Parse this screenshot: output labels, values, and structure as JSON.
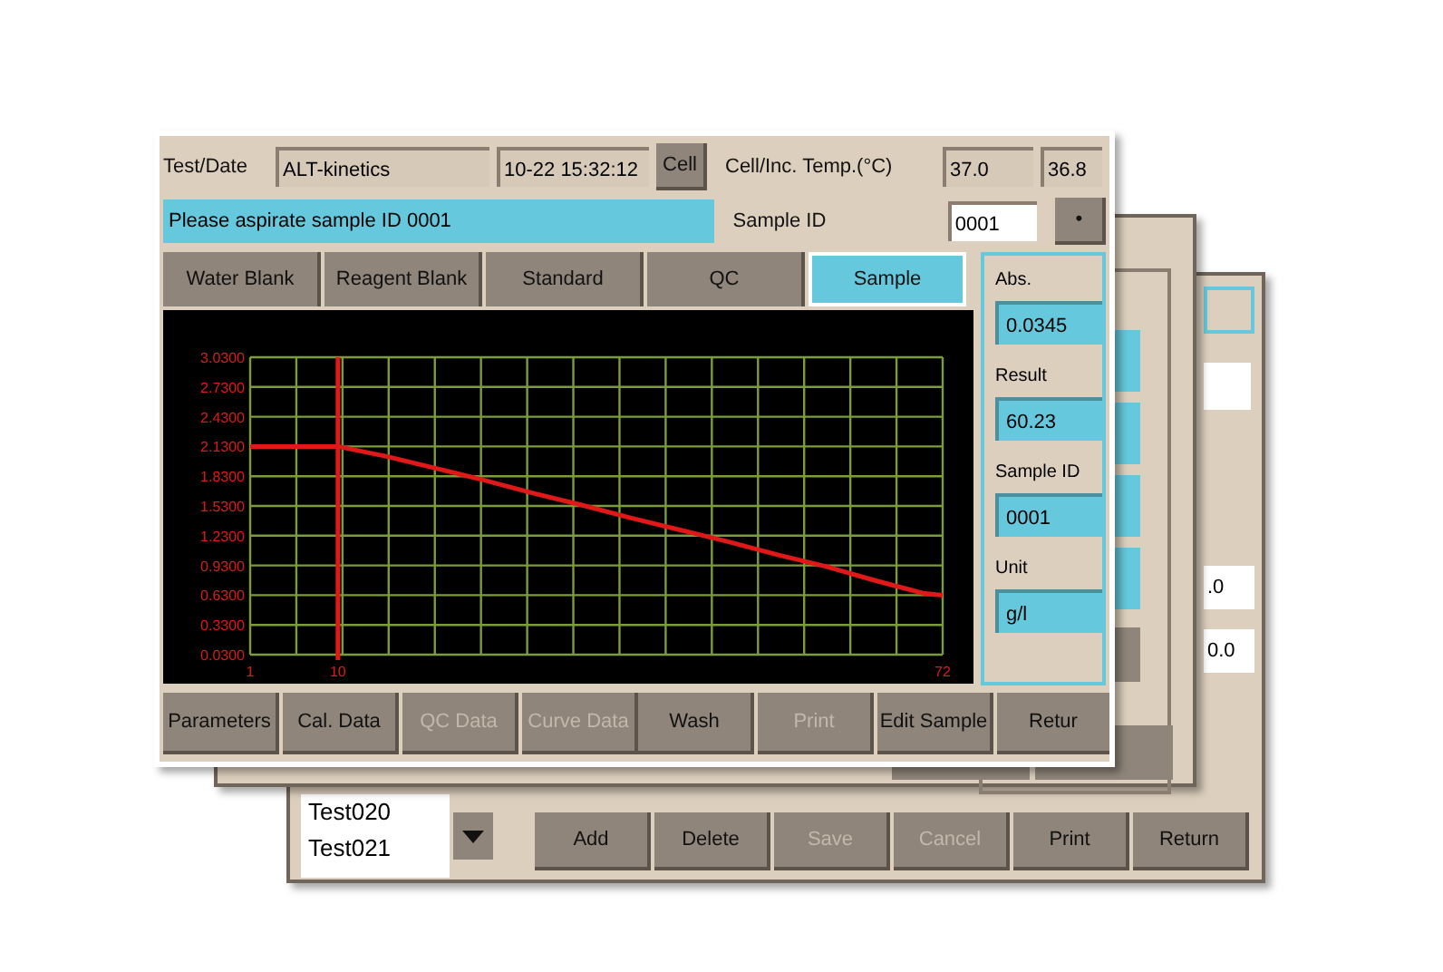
{
  "back_window": {
    "list_items": [
      "Test020",
      "Test021"
    ],
    "fields": [
      ".0",
      "0.0"
    ],
    "buttons": [
      {
        "label": "Add",
        "disabled": false
      },
      {
        "label": "Delete",
        "disabled": false
      },
      {
        "label": "Save",
        "disabled": true
      },
      {
        "label": "Cancel",
        "disabled": true
      },
      {
        "label": "Print",
        "disabled": false
      },
      {
        "label": "Return",
        "disabled": false
      }
    ]
  },
  "front_window": {
    "test_date_label": "Test/Date",
    "test_name": "ALT-kinetics",
    "datetime": "10-22 15:32:12",
    "cell_button": "Cell",
    "temp_label": "Cell/Inc. Temp.(°C)",
    "temps": [
      "37.0",
      "36.8"
    ],
    "message": "Please aspirate sample ID 0001",
    "sample_id_label": "Sample ID",
    "sample_id": "0001",
    "dot_button": "•",
    "tabs": [
      {
        "label": "Water Blank",
        "selected": false
      },
      {
        "label": "Reagent Blank",
        "selected": false
      },
      {
        "label": "Standard",
        "selected": false
      },
      {
        "label": "QC",
        "selected": false
      },
      {
        "label": "Sample",
        "selected": true
      }
    ],
    "chart_data": {
      "type": "line",
      "x": [
        1,
        10,
        15,
        20,
        25,
        30,
        35,
        40,
        45,
        50,
        55,
        60,
        65,
        70,
        72
      ],
      "grid": true,
      "series": [
        {
          "color": "#e01818",
          "values": [
            2.13,
            2.13,
            2.03,
            1.91,
            1.79,
            1.66,
            1.54,
            1.41,
            1.29,
            1.17,
            1.04,
            0.92,
            0.78,
            0.65,
            0.63
          ]
        }
      ],
      "xlim": [
        1,
        72
      ],
      "ylim": [
        0.03,
        3.03
      ],
      "xticks": [
        1,
        10,
        72
      ],
      "yticks": [
        {
          "value": 3.03,
          "label": "3.0300"
        },
        {
          "value": 2.73,
          "label": "2.7300"
        },
        {
          "value": 2.43,
          "label": "2.4300"
        },
        {
          "value": 2.13,
          "label": "2.1300"
        },
        {
          "value": 1.83,
          "label": "1.8300"
        },
        {
          "value": 1.53,
          "label": "1.5300"
        },
        {
          "value": 1.23,
          "label": "1.2300"
        },
        {
          "value": 0.93,
          "label": "0.9300"
        },
        {
          "value": 0.63,
          "label": "0.6300"
        },
        {
          "value": 0.33,
          "label": "0.3300"
        },
        {
          "value": 0.03,
          "label": "0.0300"
        }
      ],
      "ref_lines": [
        {
          "axis": "x",
          "value": 10,
          "color": "#e01818"
        }
      ]
    },
    "results": [
      {
        "label": "Abs.",
        "value": "0.0345"
      },
      {
        "label": "Result",
        "value": "60.23"
      },
      {
        "label": "Sample ID",
        "value": "0001"
      },
      {
        "label": "Unit",
        "value": "g/l"
      }
    ],
    "left_buttons": [
      {
        "label": "Parameters",
        "disabled": false
      },
      {
        "label": "Cal. Data",
        "disabled": false
      },
      {
        "label": "QC Data",
        "disabled": true
      },
      {
        "label": "Curve Data",
        "disabled": true
      }
    ],
    "right_buttons": [
      {
        "label": "Wash",
        "disabled": false
      },
      {
        "label": "Print",
        "disabled": true
      },
      {
        "label": "Edit Sample",
        "disabled": false
      },
      {
        "label": "Retur",
        "disabled": false
      }
    ]
  }
}
